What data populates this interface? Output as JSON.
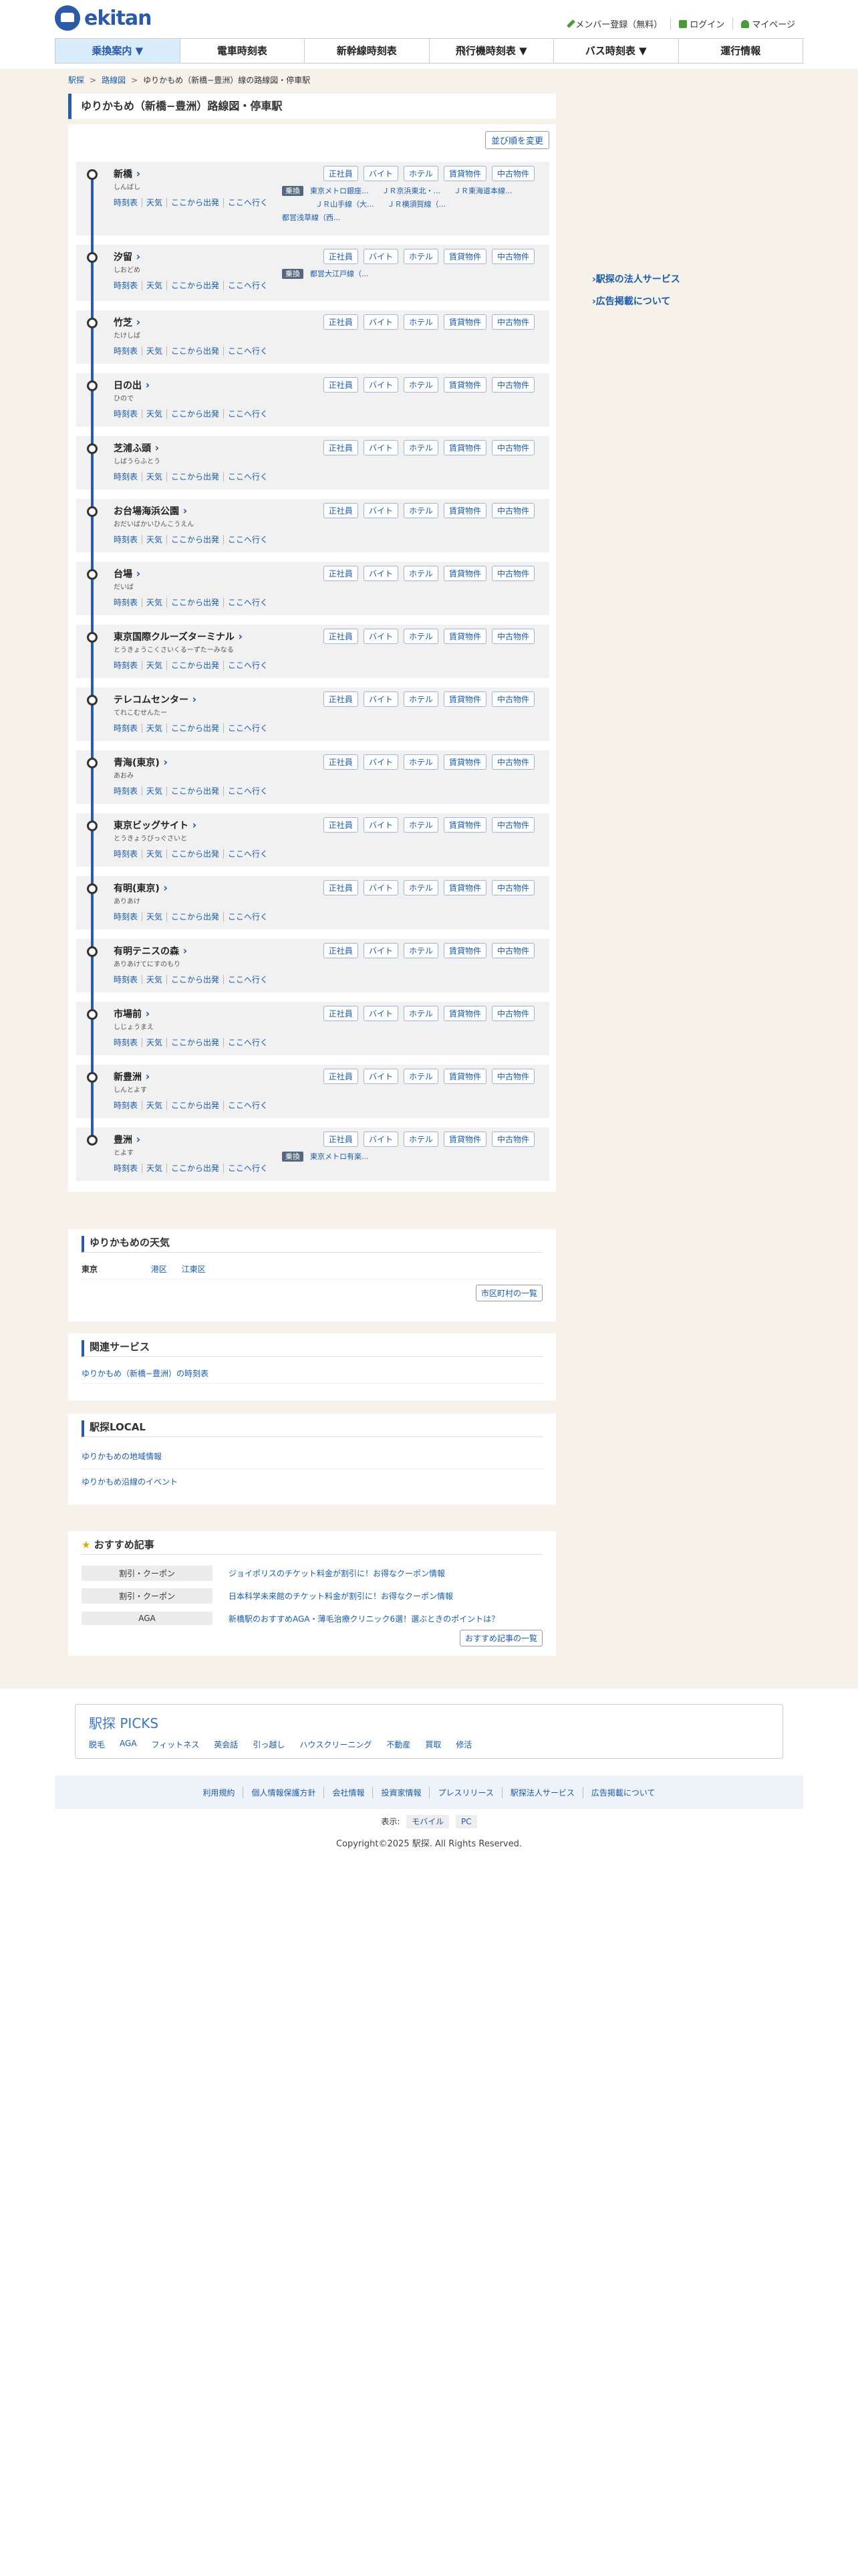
{
  "header": {
    "logo": "ekitan",
    "links": [
      "メンバー登録（無料）",
      "ログイン",
      "マイページ"
    ]
  },
  "nav": [
    "乗換案内 ▼",
    "電車時刻表",
    "新幹線時刻表",
    "飛行機時刻表 ▼",
    "バス時刻表 ▼",
    "運行情報"
  ],
  "breadcrumb": [
    "駅探",
    "路線図",
    "ゆりかもめ（新橋−豊洲）線の路線図・停車駅"
  ],
  "page_title": "ゆりかもめ（新橋−豊洲）路線図・停車駅",
  "sort_button": "並び順を変更",
  "station_links": [
    "時刻表",
    "天気",
    "ここから出発",
    "ここへ行く"
  ],
  "station_tags": [
    "正社員",
    "バイト",
    "ホテル",
    "賃貸物件",
    "中古物件"
  ],
  "transfer_label": "乗換",
  "stations": [
    {
      "name": "新橋",
      "kana": "しんばし",
      "transfer": [
        "東京メトロ銀座...",
        "ＪＲ京浜東北・...",
        "ＪＲ東海道本線...",
        "ＪＲ山手線（大...",
        "ＪＲ横須賀線（...",
        "都営浅草線（西..."
      ]
    },
    {
      "name": "汐留",
      "kana": "しおどめ",
      "transfer": [
        "都営大江戸線（..."
      ]
    },
    {
      "name": "竹芝",
      "kana": "たけしば"
    },
    {
      "name": "日の出",
      "kana": "ひので"
    },
    {
      "name": "芝浦ふ頭",
      "kana": "しばうらふとう"
    },
    {
      "name": "お台場海浜公園",
      "kana": "おだいばかいひんこうえん"
    },
    {
      "name": "台場",
      "kana": "だいば"
    },
    {
      "name": "東京国際クルーズターミナル",
      "kana": "とうきょうこくさいくるーずたーみなる"
    },
    {
      "name": "テレコムセンター",
      "kana": "てれこむせんたー"
    },
    {
      "name": "青海(東京)",
      "kana": "あおみ"
    },
    {
      "name": "東京ビッグサイト",
      "kana": "とうきょうびっぐさいと"
    },
    {
      "name": "有明(東京)",
      "kana": "ありあけ"
    },
    {
      "name": "有明テニスの森",
      "kana": "ありあけてにすのもり"
    },
    {
      "name": "市場前",
      "kana": "しじょうまえ"
    },
    {
      "name": "新豊洲",
      "kana": "しんとよす"
    },
    {
      "name": "豊洲",
      "kana": "とよす",
      "transfer": [
        "東京メトロ有楽..."
      ]
    }
  ],
  "side": [
    "駅探の法人サービス",
    "広告掲載について"
  ],
  "weather": {
    "title": "ゆりかもめの天気",
    "pref": "東京",
    "wards": [
      "港区",
      "江東区"
    ],
    "button": "市区町村の一覧"
  },
  "related": {
    "title": "関連サービス",
    "link": "ゆりかもめ（新橋−豊洲）の時刻表"
  },
  "local": {
    "title": "駅探LOCAL",
    "links": [
      "ゆりかもめの地域情報",
      "ゆりかもめ沿線のイベント"
    ]
  },
  "recommend": {
    "title": "おすすめ記事",
    "items": [
      {
        "cat": "割引・クーポン",
        "text": "ジョイポリスのチケット料金が割引に！お得なクーポン情報"
      },
      {
        "cat": "割引・クーポン",
        "text": "日本科学未来館のチケット料金が割引に！お得なクーポン情報"
      },
      {
        "cat": "AGA",
        "text": "新橋駅のおすすめAGA・薄毛治療クリニック6選！選ぶときのポイントは？"
      }
    ],
    "button": "おすすめ記事の一覧"
  },
  "picks": {
    "logo": "駅探 PICKS",
    "links": [
      "脱毛",
      "AGA",
      "フィットネス",
      "英会話",
      "引っ越し",
      "ハウスクリーニング",
      "不動産",
      "買取",
      "修活"
    ]
  },
  "footer": {
    "links": [
      "利用規約",
      "個人情報保護方針",
      "会社情報",
      "投資家情報",
      "プレスリリース",
      "駅探法人サービス",
      "広告掲載について"
    ],
    "display_label": "表示:",
    "display_opts": [
      "モバイル",
      "PC"
    ],
    "copyright": "Copyright©2025 駅探. All Rights Reserved."
  }
}
